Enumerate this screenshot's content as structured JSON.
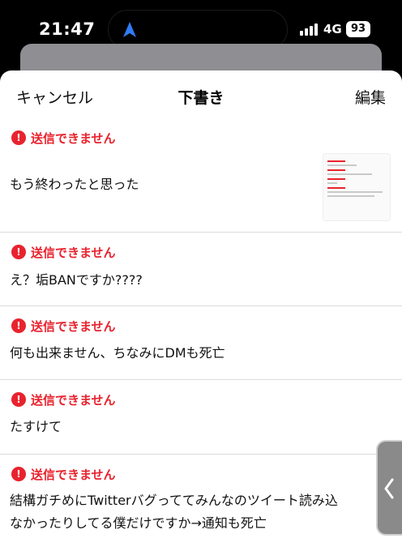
{
  "status_bar": {
    "time": "21:47",
    "network": "4G",
    "battery": "93",
    "location_icon": "navigation-arrow-icon",
    "signal_icon": "cellular-signal-icon"
  },
  "header": {
    "cancel_label": "キャンセル",
    "title": "下書き",
    "edit_label": "編集"
  },
  "error_label": "送信できません",
  "drafts": [
    {
      "error": "送信できません",
      "text": "もう終わったと思った",
      "has_thumbnail": true
    },
    {
      "error": "送信できません",
      "text": "え？垢BANですか????"
    },
    {
      "error": "送信できません",
      "text": "何も出来ません、ちなみにDMも死亡"
    },
    {
      "error": "送信できません",
      "text": "たすけて"
    },
    {
      "error": "送信できません",
      "text": "結構ガチめにTwitterバグっててみんなのツイート読み込",
      "text_line2": "なかったりしてる僕だけですか→通知も死亡"
    }
  ],
  "colors": {
    "error_red": "#e8232e",
    "sheet_bg": "#ffffff",
    "screen_bg": "#000000"
  }
}
